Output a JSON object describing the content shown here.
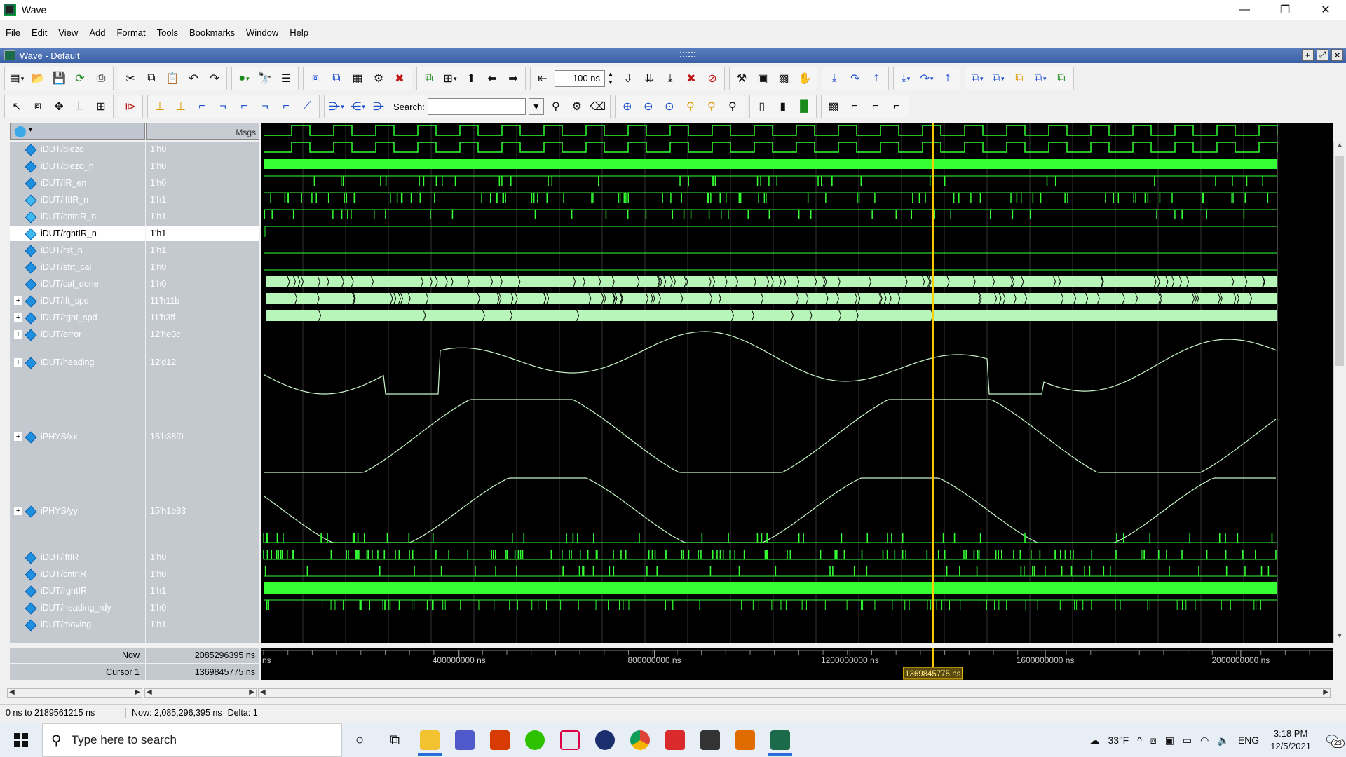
{
  "window": {
    "title": "Wave",
    "minimize_icon": "minimize-icon",
    "maximize_icon": "restore-icon",
    "close_icon": "close-icon"
  },
  "menu": [
    "File",
    "Edit",
    "View",
    "Add",
    "Format",
    "Tools",
    "Bookmarks",
    "Window",
    "Help"
  ],
  "subwindow": {
    "title": "Wave - Default"
  },
  "toolbar": {
    "time_step_value": "100 ns",
    "search_label": "Search:",
    "search_value": ""
  },
  "pane_header": {
    "msgs_label": "Msgs"
  },
  "signals": [
    {
      "name": "iDUT/piezo",
      "value": "1'h0",
      "expandable": false,
      "kind": "in"
    },
    {
      "name": "iDUT/piezo_n",
      "value": "1'h0",
      "expandable": false,
      "kind": "in"
    },
    {
      "name": "iDUT/IR_en",
      "value": "1'h0",
      "expandable": false,
      "kind": "in"
    },
    {
      "name": "iDUT/lftIR_n",
      "value": "1'h1",
      "expandable": false,
      "kind": "out"
    },
    {
      "name": "iDUT/cntrIR_n",
      "value": "1'h1",
      "expandable": false,
      "kind": "out"
    },
    {
      "name": "iDUT/rghtIR_n",
      "value": "1'h1",
      "expandable": false,
      "kind": "out",
      "selected": true
    },
    {
      "name": "iDUT/rst_n",
      "value": "1'h1",
      "expandable": false,
      "kind": "in"
    },
    {
      "name": "iDUT/strt_cal",
      "value": "1'h0",
      "expandable": false,
      "kind": "in"
    },
    {
      "name": "iDUT/cal_done",
      "value": "1'h0",
      "expandable": false,
      "kind": "in"
    },
    {
      "name": "iDUT/lft_spd",
      "value": "11'h11b",
      "expandable": true,
      "kind": "in"
    },
    {
      "name": "iDUT/rght_spd",
      "value": "11'h3ff",
      "expandable": true,
      "kind": "in"
    },
    {
      "name": "iDUT/error",
      "value": "12'he0c",
      "expandable": true,
      "kind": "in"
    },
    {
      "name": "iDUT/heading",
      "value": "12'd12",
      "expandable": true,
      "kind": "in"
    },
    {
      "name": "iPHYS/xx",
      "value": "15'h38f0",
      "expandable": true,
      "kind": "in"
    },
    {
      "name": "iPHYS/yy",
      "value": "15'h1b83",
      "expandable": true,
      "kind": "in"
    },
    {
      "name": "iDUT/lftIR",
      "value": "1'h0",
      "expandable": false,
      "kind": "in"
    },
    {
      "name": "iDUT/cntrIR",
      "value": "1'h0",
      "expandable": false,
      "kind": "in"
    },
    {
      "name": "iDUT/rghtIR",
      "value": "1'h1",
      "expandable": false,
      "kind": "in"
    },
    {
      "name": "iDUT/heading_rdy",
      "value": "1'h0",
      "expandable": false,
      "kind": "in"
    },
    {
      "name": "iDUT/moving",
      "value": "1'h1",
      "expandable": false,
      "kind": "in"
    }
  ],
  "cursor_panel": {
    "now_label": "Now",
    "now_value": "2085296395 ns",
    "cursor_label": "Cursor 1",
    "cursor_value": "1369845775 ns",
    "cursor_flag": "1369845775 ns"
  },
  "timeline": {
    "start_label": "ns",
    "ticks": [
      "400000000 ns",
      "800000000 ns",
      "1200000000 ns",
      "1600000000 ns",
      "2000000000 ns"
    ],
    "tick_values_ns": [
      400000000,
      800000000,
      1200000000,
      1600000000,
      2000000000
    ],
    "range_ns": [
      0,
      2189561215
    ],
    "cursor_ns": 1369845775
  },
  "status": {
    "range": "0 ns to 2189561215 ns",
    "now": "Now: 2,085,296,395 ns",
    "delta": "Delta: 1"
  },
  "taskbar": {
    "search_placeholder": "Type here to search",
    "weather": "33°F",
    "lang": "ENG",
    "time": "3:18 PM",
    "date": "12/5/2021",
    "notification_count": "23"
  },
  "colors": {
    "wave_green": "#33ff33",
    "bus_fill": "#b8f5b8",
    "cursor": "#ffcc00",
    "analog": "#c8f5c8"
  }
}
